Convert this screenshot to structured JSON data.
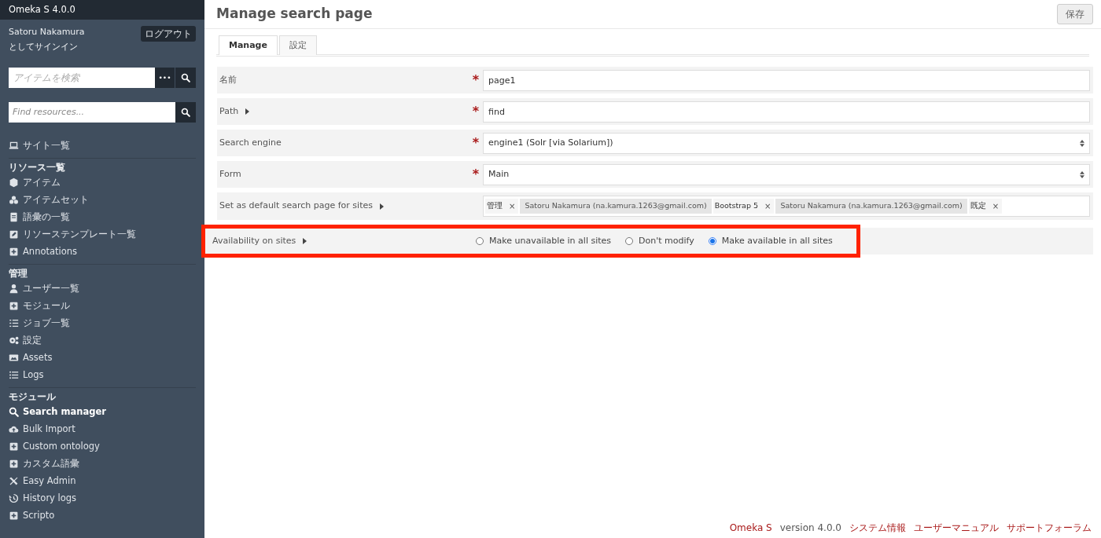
{
  "app": {
    "title": "Omeka S 4.0.0"
  },
  "user": {
    "name": "Satoru Nakamura",
    "caption": "としてサインイン",
    "logout": "ログアウト"
  },
  "item_search": {
    "placeholder": "アイテムを検索",
    "more": "•••"
  },
  "resource_search": {
    "placeholder": "Find resources..."
  },
  "nav": [
    {
      "items": [
        {
          "label": "サイト一覧",
          "selected": false
        }
      ]
    },
    {
      "heading": "リソース一覧",
      "items": [
        {
          "label": "アイテム",
          "selected": false
        },
        {
          "label": "アイテムセット",
          "selected": false
        },
        {
          "label": "語彙の一覧",
          "selected": false
        },
        {
          "label": "リソーステンプレート一覧",
          "selected": false
        },
        {
          "label": "Annotations",
          "selected": false
        }
      ]
    },
    {
      "heading": "管理",
      "items": [
        {
          "label": "ユーザー一覧",
          "selected": false
        },
        {
          "label": "モジュール",
          "selected": false
        },
        {
          "label": "ジョブ一覧",
          "selected": false
        },
        {
          "label": "設定",
          "selected": false
        },
        {
          "label": "Assets",
          "selected": false
        },
        {
          "label": "Logs",
          "selected": false
        }
      ]
    },
    {
      "heading": "モジュール",
      "items": [
        {
          "label": "Search manager",
          "selected": true
        },
        {
          "label": "Bulk Import",
          "selected": false
        },
        {
          "label": "Custom ontology",
          "selected": false
        },
        {
          "label": "カスタム語彙",
          "selected": false
        },
        {
          "label": "Easy Admin",
          "selected": false
        },
        {
          "label": "History logs",
          "selected": false
        },
        {
          "label": "Scripto",
          "selected": false
        }
      ]
    }
  ],
  "page": {
    "title": "Manage search page",
    "save": "保存"
  },
  "tabs": [
    {
      "label": "Manage",
      "selected": true
    },
    {
      "label": "設定",
      "selected": false
    }
  ],
  "fields": [
    {
      "kind": "text",
      "label": "名前",
      "required_mark": "*",
      "info": false,
      "value": "page1",
      "highlighted": false
    },
    {
      "kind": "text",
      "label": "Path",
      "required_mark": "*",
      "info": true,
      "value": "find",
      "highlighted": false
    },
    {
      "kind": "select",
      "label": "Search engine",
      "required_mark": "*",
      "info": false,
      "value": "engine1 (Solr [via Solarium])",
      "highlighted": false
    },
    {
      "kind": "select",
      "label": "Form",
      "required_mark": "*",
      "info": false,
      "value": "Main",
      "highlighted": false
    },
    {
      "kind": "chips",
      "label": "Set as default search page for sites",
      "info": true,
      "chips": [
        {
          "kind": "site",
          "text": "管理",
          "remove": "×"
        },
        {
          "kind": "owner",
          "text": "Satoru Nakamura (na.kamura.1263@gmail.com)"
        },
        {
          "kind": "site",
          "text": "Bootstrap 5",
          "remove": "×"
        },
        {
          "kind": "owner",
          "text": "Satoru Nakamura (na.kamura.1263@gmail.com)"
        },
        {
          "kind": "site",
          "text": "既定",
          "remove": "×"
        }
      ],
      "highlighted": false
    },
    {
      "kind": "radios",
      "label": "Availability on sites",
      "info": true,
      "options": [
        {
          "label": "Make unavailable in all sites",
          "selected": false
        },
        {
          "label": "Don't modify",
          "selected": false
        },
        {
          "label": "Make available in all sites",
          "selected": true
        }
      ],
      "highlighted": true
    }
  ],
  "footer": {
    "brand": "Omeka S",
    "version": "version 4.0.0",
    "links": [
      "システム情報",
      "ユーザーマニュアル",
      "サポートフォーラム"
    ]
  }
}
